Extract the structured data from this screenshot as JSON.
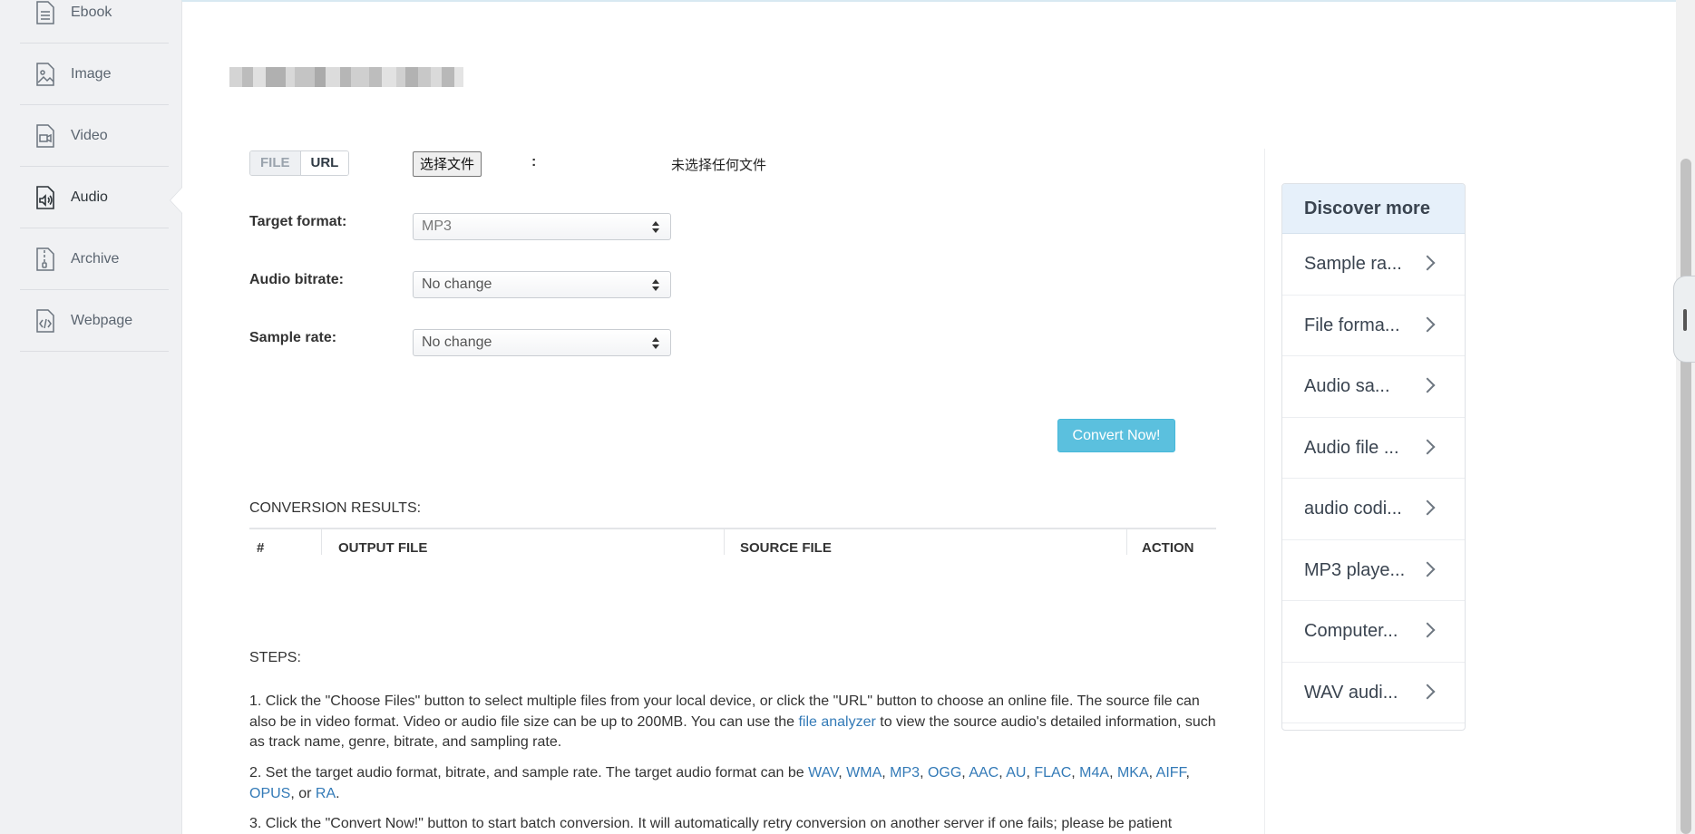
{
  "sidebar": {
    "items": [
      {
        "label": "Ebook",
        "icon": "ebook-icon",
        "active": false
      },
      {
        "label": "Image",
        "icon": "image-icon",
        "active": false
      },
      {
        "label": "Video",
        "icon": "video-icon",
        "active": false
      },
      {
        "label": "Audio",
        "icon": "audio-icon",
        "active": true
      },
      {
        "label": "Archive",
        "icon": "archive-icon",
        "active": false
      },
      {
        "label": "Webpage",
        "icon": "webpage-icon",
        "active": false
      }
    ]
  },
  "source": {
    "tab_file": "FILE",
    "tab_url": "URL",
    "colon": ":",
    "choose_button": "选择文件",
    "no_file_text": "未选择任何文件"
  },
  "form": {
    "target_format_label": "Target format:",
    "target_format_value": "MP3",
    "bitrate_label": "Audio bitrate:",
    "bitrate_value": "No change",
    "sample_rate_label": "Sample rate:",
    "sample_rate_value": "No change",
    "convert_button": "Convert Now!"
  },
  "results": {
    "title": "CONVERSION RESULTS:",
    "columns": [
      "#",
      "OUTPUT FILE",
      "SOURCE FILE",
      "ACTION"
    ]
  },
  "steps": {
    "title": "STEPS:",
    "step1_a": "1. Click the \"Choose Files\" button to select multiple files from your local device, or click the \"URL\" button to choose an online file. The source file can also be in video format. Video or audio file size can be up to 200MB. You can use the ",
    "step1_link": "file analyzer",
    "step1_b": " to view the source audio's detailed information, such as track name, genre, bitrate, and sampling rate.",
    "step2_a": "2. Set the target audio format, bitrate, and sample rate. The target audio format can be ",
    "step2_formats": [
      "WAV",
      "WMA",
      "MP3",
      "OGG",
      "AAC",
      "AU",
      "FLAC",
      "M4A",
      "MKA",
      "AIFF",
      "OPUS"
    ],
    "step2_or": ", or ",
    "step2_last": "RA",
    "step2_end": ".",
    "step3": "3. Click the \"Convert Now!\" button to start batch conversion. It will automatically retry conversion on another server if one fails; please be patient"
  },
  "discover": {
    "title": "Discover more",
    "items": [
      "Sample ra...",
      "File forma...",
      "Audio sa...",
      "Audio file ...",
      "audio codi...",
      "MP3 playe...",
      "Computer...",
      "WAV audi..."
    ]
  },
  "colors": {
    "accent": "#5bc0de",
    "link": "#337ab7",
    "discover_header": "#e6f0fa"
  }
}
